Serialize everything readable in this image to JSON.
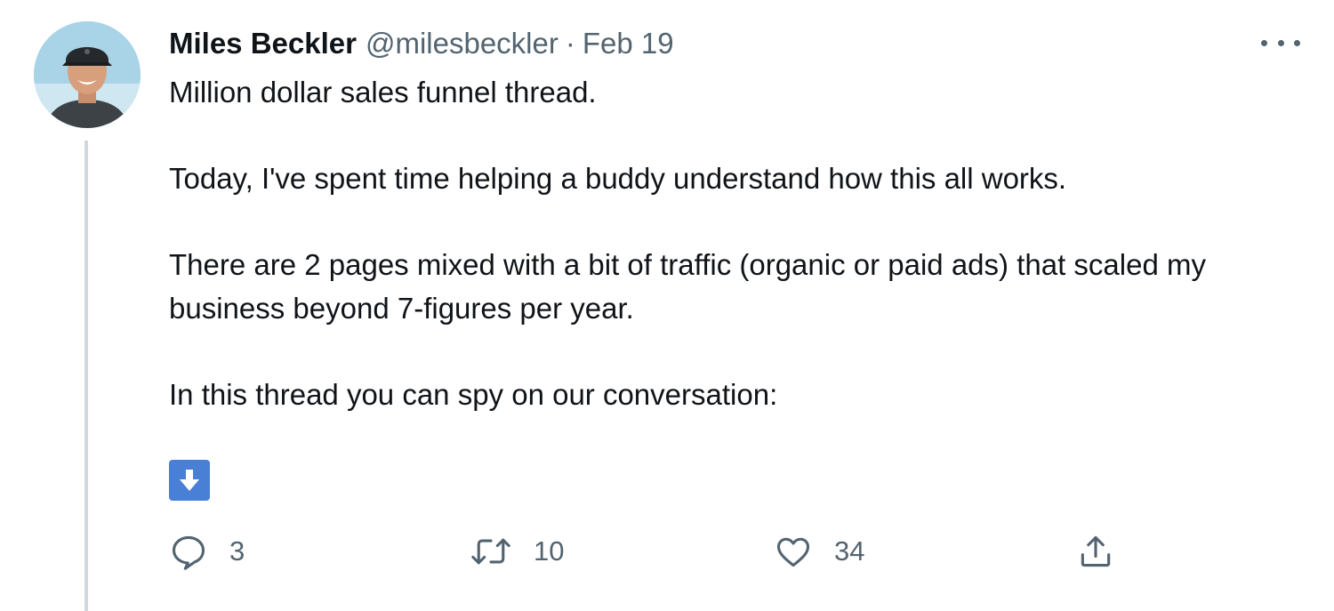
{
  "author": {
    "name": "Miles Beckler",
    "handle": "@milesbeckler",
    "separator": "·",
    "date": "Feb 19"
  },
  "tweet": {
    "paragraphs": [
      "Million dollar sales funnel thread.",
      "Today, I've spent time helping a buddy understand how this all works.",
      "There are 2 pages mixed with a bit of traffic (organic or paid ads) that scaled my business beyond 7-figures per year.",
      "In this thread you can spy on our conversation:"
    ],
    "emoji": "down-arrow-emoji"
  },
  "actions": {
    "reply_count": "3",
    "retweet_count": "10",
    "like_count": "34"
  },
  "icons": {
    "more": "more-horizontal-icon",
    "reply": "reply-icon",
    "retweet": "retweet-icon",
    "like": "heart-icon",
    "share": "share-icon"
  },
  "colors": {
    "text": "#0f1419",
    "secondary": "#536471",
    "thread_line": "#cfd9de",
    "emoji_bg": "#4a7fd6"
  }
}
